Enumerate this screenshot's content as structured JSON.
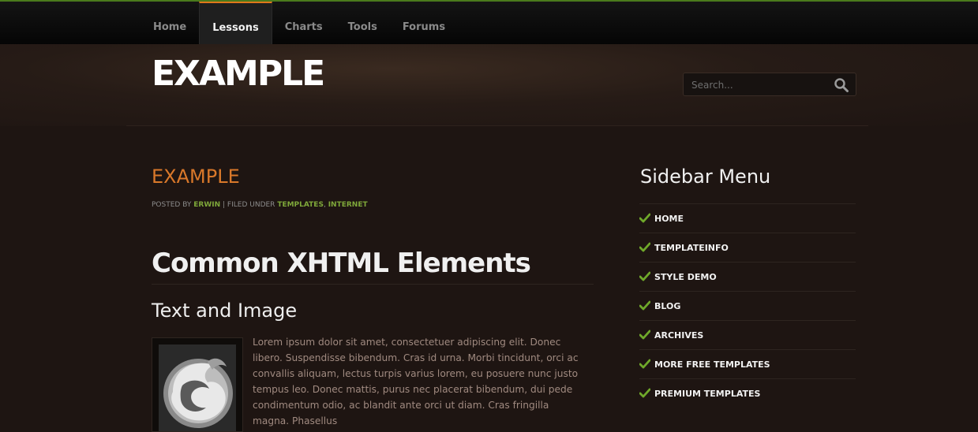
{
  "nav": {
    "items": [
      {
        "label": "Home",
        "active": false
      },
      {
        "label": "Lessons",
        "active": true
      },
      {
        "label": "Charts",
        "active": false
      },
      {
        "label": "Tools",
        "active": false
      },
      {
        "label": "Forums",
        "active": false
      }
    ]
  },
  "header": {
    "logo": "EXAMPLE",
    "search_placeholder": "Search..."
  },
  "post": {
    "title": "EXAMPLE",
    "meta": {
      "posted_by_label": "POSTED BY",
      "author": "ERWIN",
      "filed_under_label": "| FILED UNDER",
      "category1": "TEMPLATES",
      "separator": ",",
      "category2": "INTERNET"
    },
    "heading1": "Common XHTML Elements",
    "heading2": "Text and Image",
    "body": "Lorem ipsum dolor sit amet, consectetuer adipiscing elit. Donec libero. Suspendisse bibendum. Cras id urna. Morbi tincidunt, orci ac convallis aliquam, lectus turpis varius lorem, eu posuere nunc justo tempus leo. Donec mattis, purus nec placerat bibendum, dui pede condimentum odio, ac blandit ante orci ut diam. Cras fringilla magna. Phasellus"
  },
  "sidebar": {
    "title": "Sidebar Menu",
    "items": [
      {
        "label": "HOME"
      },
      {
        "label": "TEMPLATEINFO"
      },
      {
        "label": "STYLE DEMO"
      },
      {
        "label": "BLOG"
      },
      {
        "label": "ARCHIVES"
      },
      {
        "label": "MORE FREE TEMPLATES"
      },
      {
        "label": "PREMIUM TEMPLATES"
      }
    ]
  },
  "colors": {
    "accent_orange": "#d9782a",
    "link_green": "#7fa83a",
    "background": "#1e1512"
  },
  "icons": {
    "search": "search-icon",
    "check": "check-icon",
    "image": "firefox-logo-image"
  }
}
